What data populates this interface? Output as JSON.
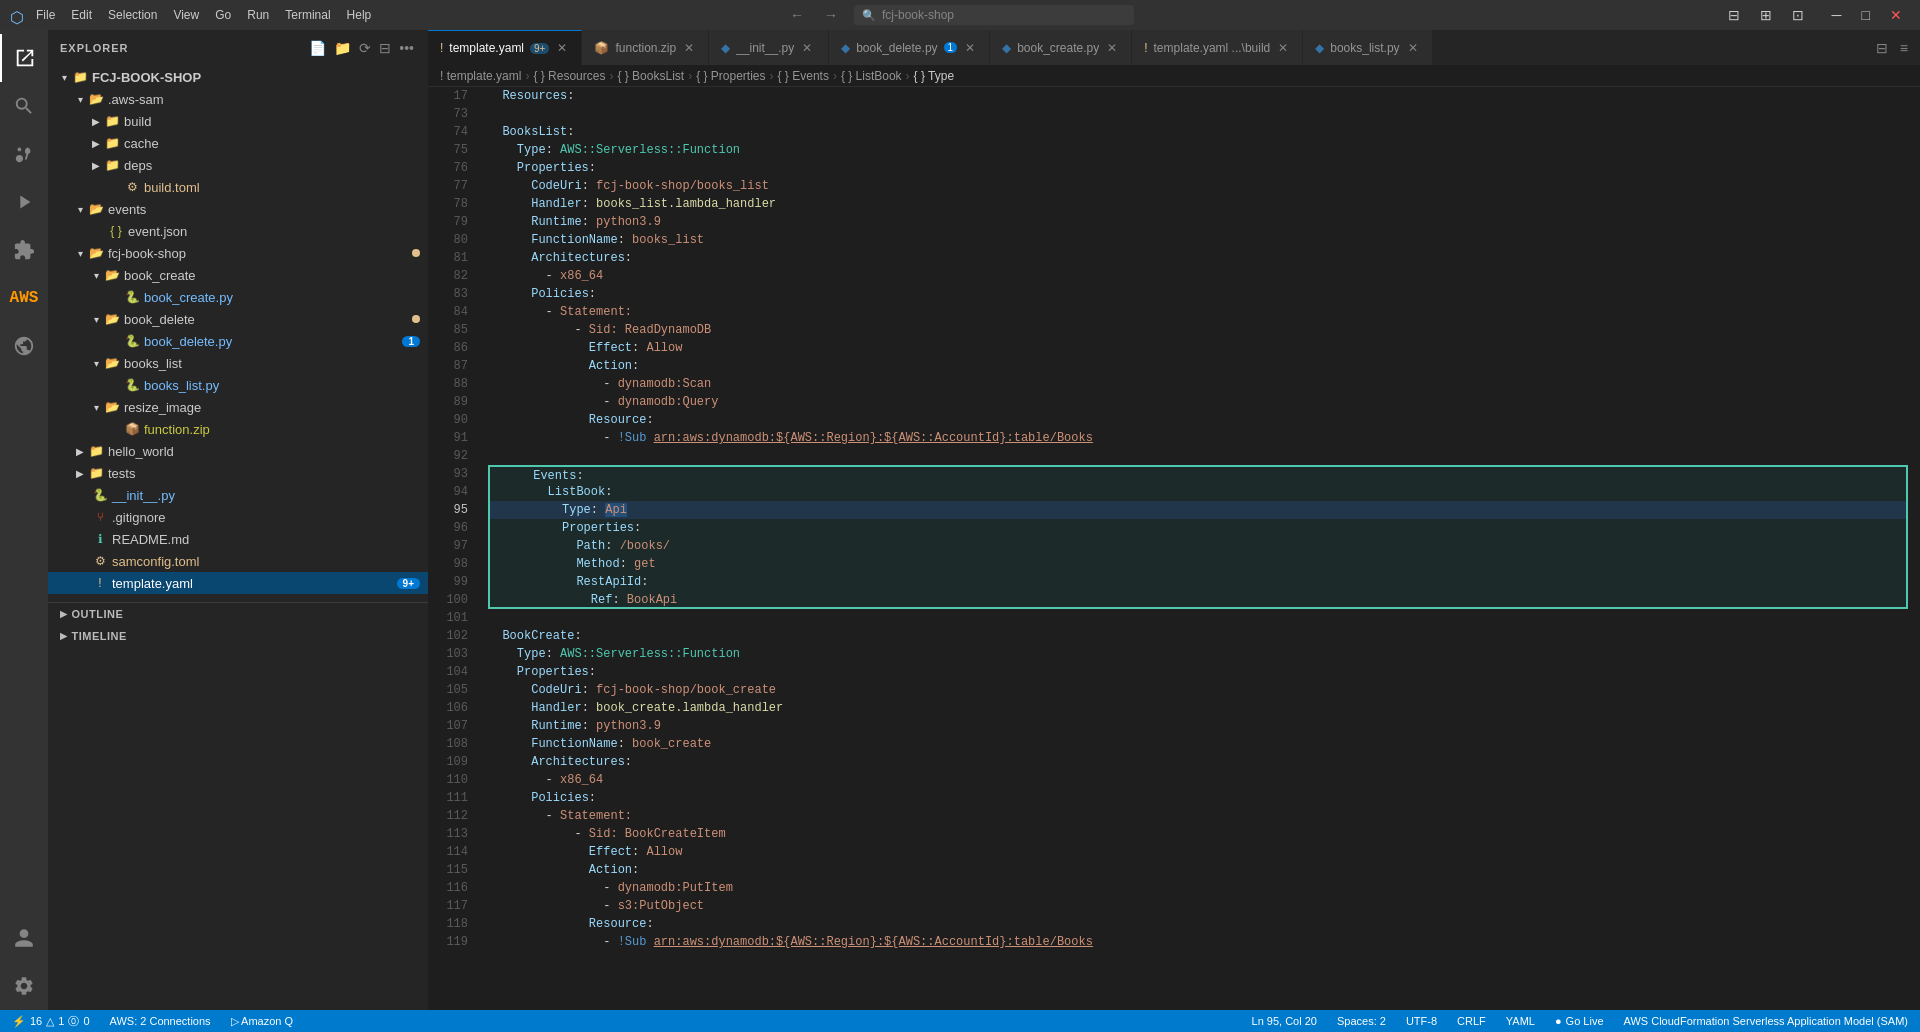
{
  "titlebar": {
    "icon": "🔲",
    "menu_items": [
      "File",
      "Edit",
      "Selection",
      "View",
      "Go",
      "Run",
      "Terminal",
      "Help"
    ],
    "search_placeholder": "fcj-book-shop",
    "nav_back": "←",
    "nav_forward": "→",
    "win_minimize": "─",
    "win_maximize": "□",
    "win_close": "✕"
  },
  "activity_bar": {
    "icons": [
      {
        "name": "explorer-icon",
        "symbol": "⎗",
        "active": true
      },
      {
        "name": "search-icon",
        "symbol": "🔍",
        "active": false
      },
      {
        "name": "source-control-icon",
        "symbol": "⑂",
        "active": false
      },
      {
        "name": "run-debug-icon",
        "symbol": "▷",
        "active": false
      },
      {
        "name": "extensions-icon",
        "symbol": "⊞",
        "active": false
      },
      {
        "name": "aws-icon",
        "symbol": "☁",
        "active": false
      },
      {
        "name": "remote-icon",
        "symbol": "⚡",
        "active": false
      }
    ],
    "bottom_icons": [
      {
        "name": "account-icon",
        "symbol": "◯"
      },
      {
        "name": "settings-icon",
        "symbol": "⚙"
      }
    ]
  },
  "sidebar": {
    "title": "EXPLORER",
    "root": "FCJ-BOOK-SHOP",
    "tree": [
      {
        "id": "aws-sam",
        "label": ".aws-sam",
        "type": "folder",
        "depth": 1,
        "expanded": true
      },
      {
        "id": "build",
        "label": "build",
        "type": "folder",
        "depth": 2,
        "expanded": false
      },
      {
        "id": "cache",
        "label": "cache",
        "type": "folder",
        "depth": 2,
        "expanded": false
      },
      {
        "id": "deps",
        "label": "deps",
        "type": "folder",
        "depth": 2,
        "expanded": false
      },
      {
        "id": "build-toml",
        "label": "build.toml",
        "type": "file",
        "depth": 2,
        "color": "orange"
      },
      {
        "id": "events",
        "label": "events",
        "type": "folder",
        "depth": 1,
        "expanded": true
      },
      {
        "id": "event-json",
        "label": "event.json",
        "type": "file",
        "depth": 2,
        "color": "yellow"
      },
      {
        "id": "fcj-book-shop",
        "label": "fcj-book-shop",
        "type": "folder",
        "depth": 1,
        "expanded": true,
        "badge": "•"
      },
      {
        "id": "book-create",
        "label": "book_create",
        "type": "folder",
        "depth": 2,
        "expanded": true
      },
      {
        "id": "book-create-py",
        "label": "book_create.py",
        "type": "file-py",
        "depth": 3,
        "color": "blue"
      },
      {
        "id": "book-delete",
        "label": "book_delete",
        "type": "folder",
        "depth": 2,
        "expanded": true,
        "badge": "•"
      },
      {
        "id": "book-delete-py",
        "label": "book_delete.py",
        "type": "file-py",
        "depth": 3,
        "color": "blue",
        "modified": "1"
      },
      {
        "id": "books-list",
        "label": "books_list",
        "type": "folder",
        "depth": 2,
        "expanded": true
      },
      {
        "id": "books-list-py",
        "label": "books_list.py",
        "type": "file-py",
        "depth": 3,
        "color": "blue"
      },
      {
        "id": "resize-image",
        "label": "resize_image",
        "type": "folder",
        "depth": 2,
        "expanded": true
      },
      {
        "id": "function-zip",
        "label": "function.zip",
        "type": "file-zip",
        "depth": 3,
        "color": "yellow"
      },
      {
        "id": "hello-world",
        "label": "hello_world",
        "type": "folder",
        "depth": 1,
        "expanded": false
      },
      {
        "id": "tests",
        "label": "tests",
        "type": "folder",
        "depth": 1,
        "expanded": false
      },
      {
        "id": "init-py",
        "label": "__init__.py",
        "type": "file-py",
        "depth": 1,
        "color": "blue"
      },
      {
        "id": "gitignore",
        "label": ".gitignore",
        "type": "file",
        "depth": 1
      },
      {
        "id": "readme",
        "label": "README.md",
        "type": "file-md",
        "depth": 1,
        "color": "info"
      },
      {
        "id": "samconfig",
        "label": "samconfig.toml",
        "type": "file",
        "depth": 1,
        "color": "orange"
      },
      {
        "id": "template-yaml",
        "label": "template.yaml",
        "type": "file-yaml",
        "depth": 1,
        "color": "orange",
        "badge": "9+",
        "selected": true
      }
    ],
    "outline_label": "OUTLINE",
    "timeline_label": "TIMELINE"
  },
  "tabs": [
    {
      "id": "template-yaml",
      "label": "template.yaml",
      "icon": "!",
      "badge": "9+",
      "active": true,
      "type": "yaml"
    },
    {
      "id": "function-zip",
      "label": "function.zip",
      "icon": "📦",
      "active": false,
      "type": "zip"
    },
    {
      "id": "init-py",
      "label": "__init__.py",
      "icon": "◆",
      "active": false,
      "type": "py"
    },
    {
      "id": "book-delete-py",
      "label": "book_delete.py",
      "icon": "◆",
      "active": false,
      "type": "py",
      "modified": true,
      "badge": "1"
    },
    {
      "id": "book-create-py",
      "label": "book_create.py",
      "icon": "◆",
      "active": false,
      "type": "py"
    },
    {
      "id": "template-yaml2",
      "label": "template.yaml",
      "icon": "!",
      "active": false,
      "type": "yaml",
      "path": "...\\build"
    },
    {
      "id": "books-list-py",
      "label": "books_list.py",
      "icon": "◆",
      "active": false,
      "type": "py"
    }
  ],
  "breadcrumb": {
    "items": [
      "template.yaml",
      "Resources",
      "BooksList",
      "Properties",
      "Events",
      "ListBook",
      "Type"
    ]
  },
  "editor": {
    "language": "yaml",
    "lines": [
      {
        "num": 17,
        "content": "  Resources:"
      },
      {
        "num": 73,
        "content": ""
      },
      {
        "num": 74,
        "content": "  BooksList:"
      },
      {
        "num": 75,
        "content": "    Type: AWS::Serverless::Function"
      },
      {
        "num": 76,
        "content": "    Properties:"
      },
      {
        "num": 77,
        "content": "      CodeUri: fcj-book-shop/books_list"
      },
      {
        "num": 78,
        "content": "      Handler: books_list.lambda_handler"
      },
      {
        "num": 79,
        "content": "      Runtime: python3.9"
      },
      {
        "num": 80,
        "content": "      FunctionName: books_list"
      },
      {
        "num": 81,
        "content": "      Architectures:"
      },
      {
        "num": 82,
        "content": "        - x86_64"
      },
      {
        "num": 83,
        "content": "      Policies:"
      },
      {
        "num": 84,
        "content": "        - Statement:"
      },
      {
        "num": 85,
        "content": "            - Sid: ReadDynamoDB"
      },
      {
        "num": 86,
        "content": "              Effect: Allow"
      },
      {
        "num": 87,
        "content": "              Action:"
      },
      {
        "num": 88,
        "content": "                - dynamodb:Scan"
      },
      {
        "num": 89,
        "content": "                - dynamodb:Query"
      },
      {
        "num": 90,
        "content": "              Resource:"
      },
      {
        "num": 91,
        "content": "                - !Sub arn:aws:dynamodb:${AWS::Region}:${AWS::AccountId}:table/Books"
      },
      {
        "num": 92,
        "content": ""
      },
      {
        "num": 93,
        "content": "      Events:"
      },
      {
        "num": 94,
        "content": "        ListBook:"
      },
      {
        "num": 95,
        "content": "          Type: Api"
      },
      {
        "num": 96,
        "content": "          Properties:"
      },
      {
        "num": 97,
        "content": "            Path: /books/"
      },
      {
        "num": 98,
        "content": "            Method: get"
      },
      {
        "num": 99,
        "content": "            RestApiId:"
      },
      {
        "num": 100,
        "content": "              Ref: BookApi"
      },
      {
        "num": 101,
        "content": ""
      },
      {
        "num": 102,
        "content": "  BookCreate:"
      },
      {
        "num": 103,
        "content": "    Type: AWS::Serverless::Function"
      },
      {
        "num": 104,
        "content": "    Properties:"
      },
      {
        "num": 105,
        "content": "      CodeUri: fcj-book-shop/book_create"
      },
      {
        "num": 106,
        "content": "      Handler: book_create.lambda_handler"
      },
      {
        "num": 107,
        "content": "      Runtime: python3.9"
      },
      {
        "num": 108,
        "content": "      FunctionName: book_create"
      },
      {
        "num": 109,
        "content": "      Architectures:"
      },
      {
        "num": 110,
        "content": "        - x86_64"
      },
      {
        "num": 111,
        "content": "      Policies:"
      },
      {
        "num": 112,
        "content": "        - Statement:"
      },
      {
        "num": 113,
        "content": "            - Sid: BookCreateItem"
      },
      {
        "num": 114,
        "content": "              Effect: Allow"
      },
      {
        "num": 115,
        "content": "              Action:"
      },
      {
        "num": 116,
        "content": "                - dynamodb:PutItem"
      },
      {
        "num": 117,
        "content": "                - s3:PutObject"
      },
      {
        "num": 118,
        "content": "              Resource:"
      },
      {
        "num": 119,
        "content": "                - !Sub arn:aws:dynamodb:${AWS::Region}:${AWS::AccountId}:table/Books"
      }
    ],
    "current_line": 95,
    "selection_range": {
      "start": 93,
      "end": 100
    }
  },
  "status_bar": {
    "left": [
      {
        "id": "remote",
        "text": "⚡ 16 △1 ⓪0"
      },
      {
        "id": "aws-connections",
        "text": "AWS: 2 Connections"
      },
      {
        "id": "amazon-q",
        "text": "▷ Amazon Q"
      }
    ],
    "right": [
      {
        "id": "cursor-pos",
        "text": "Ln 95, Col 20"
      },
      {
        "id": "spaces",
        "text": "Spaces: 2"
      },
      {
        "id": "encoding",
        "text": "UTF-8"
      },
      {
        "id": "line-ending",
        "text": "CRLF"
      },
      {
        "id": "language",
        "text": "YAML"
      },
      {
        "id": "go-live",
        "text": "Go Live"
      },
      {
        "id": "aws-cloudformation",
        "text": "AWS CloudFormation Serverless Application Model (SAM)"
      }
    ]
  }
}
